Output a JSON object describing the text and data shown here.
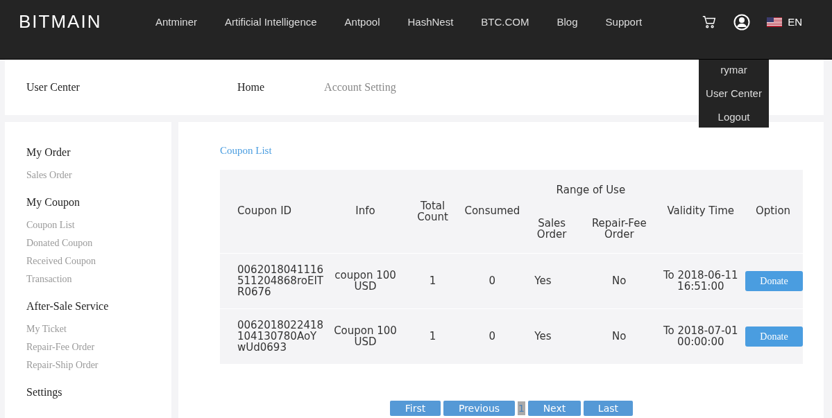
{
  "header": {
    "logo": "BITMAIN",
    "nav": [
      "Antminer",
      "Artificial Intelligence",
      "Antpool",
      "HashNest",
      "BTC.COM",
      "Blog",
      "Support"
    ],
    "language": "EN"
  },
  "user_menu": [
    "rymar",
    "User Center",
    "Logout"
  ],
  "subheader": {
    "title": "User Center",
    "links": [
      {
        "label": "Home",
        "selected": true
      },
      {
        "label": "Account Setting",
        "selected": false
      }
    ]
  },
  "sidebar": [
    {
      "heading": "My Order",
      "items": [
        "Sales Order"
      ]
    },
    {
      "heading": "My Coupon",
      "items": [
        "Coupon List",
        "Donated Coupon",
        "Received Coupon",
        "Transaction"
      ]
    },
    {
      "heading": "After-Sale Service",
      "items": [
        "My Ticket",
        "Repair-Fee Order",
        "Repair-Ship Order"
      ]
    },
    {
      "heading": "Settings"
    }
  ],
  "content": {
    "title": "Coupon List",
    "table": {
      "columns": [
        "Coupon ID",
        "Info",
        "Total Count",
        "Consumed",
        "Range of Use",
        "Sales Order",
        "Repair-Fee Order",
        "Validity Time",
        "Option"
      ],
      "rows": [
        {
          "id": "0062018041116511204868roEITR0676",
          "info": "coupon 100 USD",
          "total": "1",
          "consumed": "0",
          "sales": "Yes",
          "repair": "No",
          "validity": "To 2018-06-11 16:51:00",
          "action": "Donate"
        },
        {
          "id": "0062018022418104130780AoYwUd0693",
          "info": "Coupon 100 USD",
          "total": "1",
          "consumed": "0",
          "sales": "Yes",
          "repair": "No",
          "validity": "To 2018-07-01 00:00:00",
          "action": "Donate"
        }
      ]
    }
  },
  "pagination": {
    "buttons": [
      "First",
      "Previous",
      "Next",
      "Last"
    ],
    "current": "1"
  }
}
